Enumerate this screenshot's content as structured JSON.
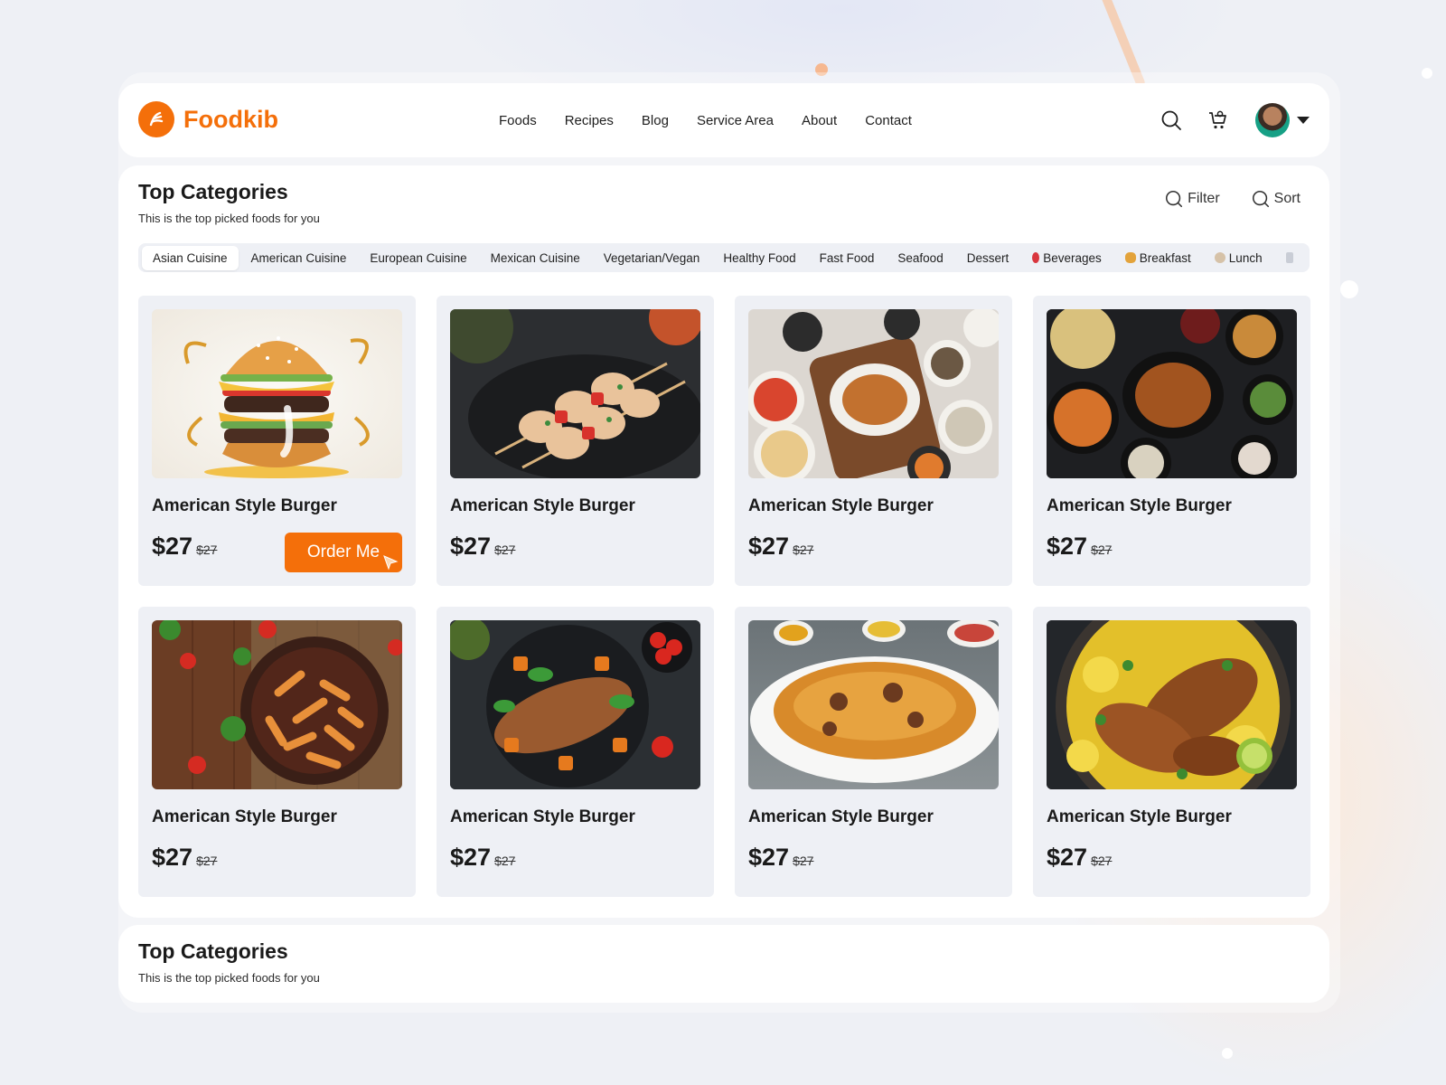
{
  "brand": {
    "name": "Foodkib",
    "accent": "#f46f0a"
  },
  "nav": [
    "Foods",
    "Recipes",
    "Blog",
    "Service Area",
    "About",
    "Contact"
  ],
  "header_icons": [
    "search-icon",
    "cart-icon",
    "avatar",
    "chevron-down-icon"
  ],
  "section": {
    "title": "Top Categories",
    "subtitle": "This is the top picked foods for you",
    "filter_label": "Filter",
    "sort_label": "Sort"
  },
  "categories": [
    "Asian Cuisine",
    "American Cuisine",
    "European Cuisine",
    "Mexican Cuisine",
    "Vegetarian/Vegan",
    "Healthy Food",
    "Fast Food",
    "Seafood",
    "Dessert",
    "Beverages",
    "Breakfast",
    "Lunch"
  ],
  "active_category": "Asian Cuisine",
  "cards": [
    {
      "name": "American Style Burger",
      "price": "$27",
      "old_price": "$27",
      "image": "burger",
      "cta": "Order Me"
    },
    {
      "name": "American Style Burger",
      "price": "$27",
      "old_price": "$27",
      "image": "chicken-skewers"
    },
    {
      "name": "American Style Burger",
      "price": "$27",
      "old_price": "$27",
      "image": "roast-chicken-spread"
    },
    {
      "name": "American Style Burger",
      "price": "$27",
      "old_price": "$27",
      "image": "dark-table-feast"
    },
    {
      "name": "American Style Burger",
      "price": "$27",
      "old_price": "$27",
      "image": "penne-pasta"
    },
    {
      "name": "American Style Burger",
      "price": "$27",
      "old_price": "$27",
      "image": "grilled-fish-vegetables"
    },
    {
      "name": "American Style Burger",
      "price": "$27",
      "old_price": "$27",
      "image": "biryani-rice"
    },
    {
      "name": "American Style Burger",
      "price": "$27",
      "old_price": "$27",
      "image": "chicken-rice-bowl"
    }
  ],
  "bottom_section": {
    "title": "Top Categories",
    "subtitle": "This is the top picked foods for you"
  }
}
